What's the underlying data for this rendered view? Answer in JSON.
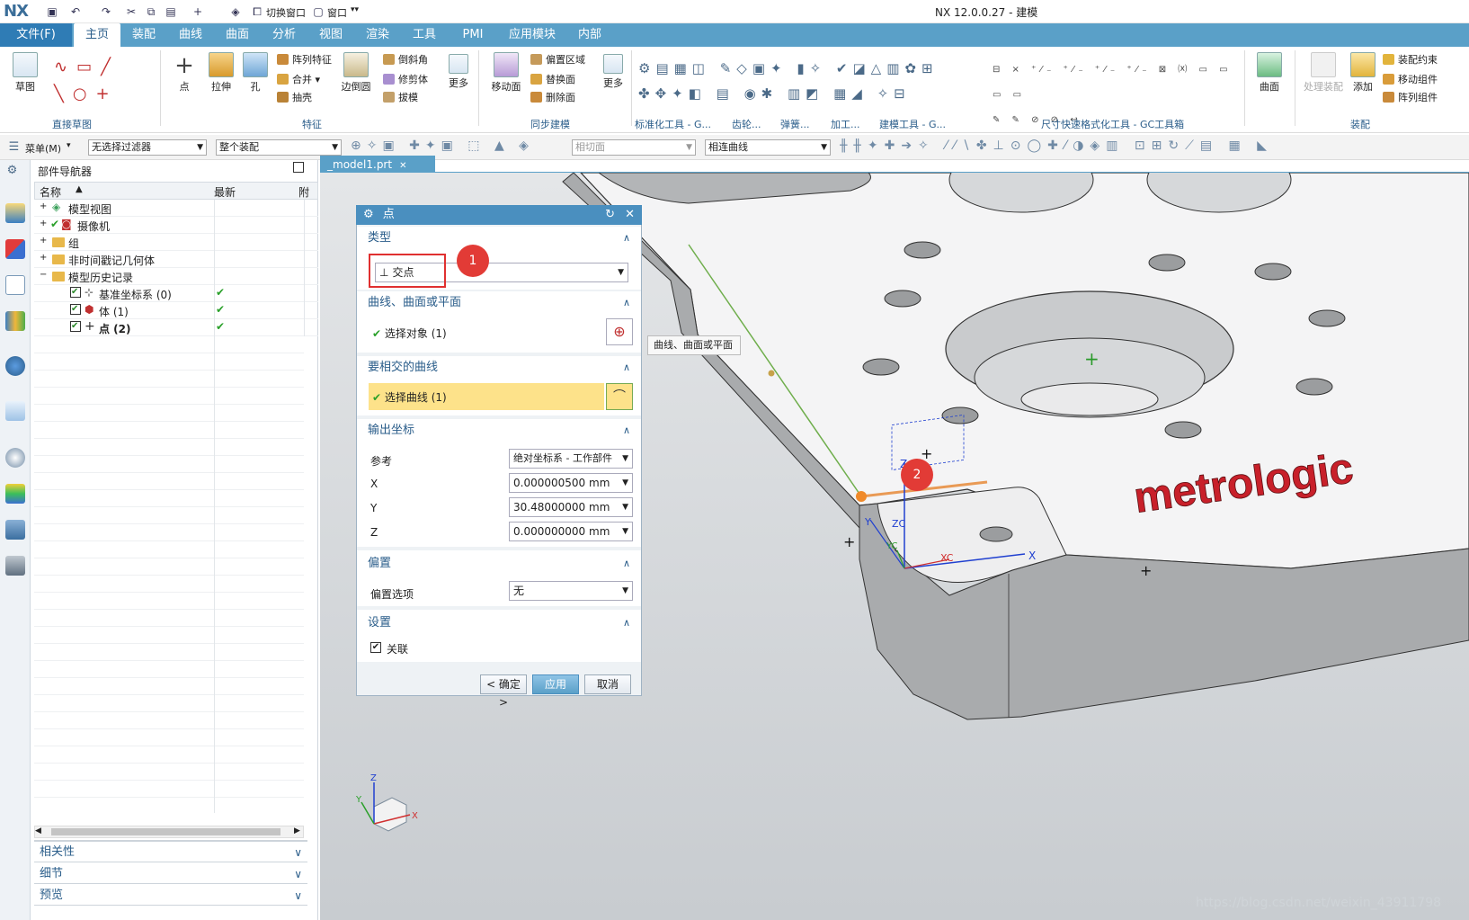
{
  "app": {
    "logo": "NX",
    "title": "NX 12.0.0.27 - 建模",
    "quick_access": {
      "switch_window": "切换窗口",
      "window_menu": "窗口"
    }
  },
  "tabs": [
    {
      "label": "文件(F)"
    },
    {
      "label": "主页"
    },
    {
      "label": "装配"
    },
    {
      "label": "曲线"
    },
    {
      "label": "曲面"
    },
    {
      "label": "分析"
    },
    {
      "label": "视图"
    },
    {
      "label": "渲染"
    },
    {
      "label": "工具"
    },
    {
      "label": "PMI"
    },
    {
      "label": "应用模块"
    },
    {
      "label": "内部"
    }
  ],
  "ribbon": {
    "sketch": "草图",
    "direct_sketch_group": "直接草图",
    "point": "点",
    "extrude": "拉伸",
    "hole": "孔",
    "pattern_feature": "阵列特征",
    "unite": "合并",
    "shell": "抽壳",
    "edge_blend": "边倒圆",
    "chamfer": "倒斜角",
    "trim_body": "修剪体",
    "draft": "拔模",
    "more1": "更多",
    "feature_group": "特征",
    "move_face": "移动面",
    "offset_region": "偏置区域",
    "replace_face": "替换面",
    "delete_face": "删除面",
    "more2": "更多",
    "sync_group": "同步建模",
    "std_tools_group": "标准化工具 - G...",
    "gear_group": "齿轮...",
    "spring_group": "弹簧...",
    "process_group": "加工...",
    "modeling_tools_group": "建模工具 - G...",
    "dim_group": "尺寸快速格式化工具 - GC工具箱",
    "surface": "曲面",
    "process_assembly": "处理装配",
    "add": "添加",
    "assembly_constraint": "装配约束",
    "move_component": "移动组件",
    "pattern_component": "阵列组件",
    "assembly_group": "装配"
  },
  "selbar": {
    "menu": "菜单(M)",
    "filter": "无选择过滤器",
    "scope": "整个装配",
    "face_rule": "相切面",
    "curve_rule": "相连曲线"
  },
  "navigator": {
    "title": "部件导航器",
    "col_name": "名称",
    "col_latest": "最新",
    "col_extra": "附",
    "rows": [
      {
        "label": "模型视图",
        "indent": 0,
        "latest": ""
      },
      {
        "label": "摄像机",
        "indent": 0,
        "latest": ""
      },
      {
        "label": "组",
        "indent": 0,
        "latest": ""
      },
      {
        "label": "非时间戳记几何体",
        "indent": 0,
        "latest": ""
      },
      {
        "label": "模型历史记录",
        "indent": 0,
        "latest": ""
      },
      {
        "label": "基准坐标系 (0)",
        "indent": 1,
        "latest": "✔"
      },
      {
        "label": "体 (1)",
        "indent": 1,
        "latest": "✔"
      },
      {
        "label": "点 (2)",
        "indent": 1,
        "latest": "✔"
      }
    ],
    "panels": [
      "相关性",
      "细节",
      "预览"
    ]
  },
  "graphics": {
    "tab_label": "_model1.prt",
    "text_on_part": "metrologic",
    "triad": {
      "x": "X",
      "y": "Y",
      "z": "Z",
      "xc": "XC",
      "yc": "YC",
      "zc": "ZC"
    }
  },
  "dialog": {
    "title": "点",
    "type_section": "类型",
    "type_value": "交点",
    "curves_section": "曲线、曲面或平面",
    "select_object": "选择对象 (1)",
    "intersect_section": "要相交的曲线",
    "select_curve": "选择曲线 (1)",
    "output_section": "输出坐标",
    "ref_label": "参考",
    "ref_value": "绝对坐标系 - 工作部件",
    "x_label": "X",
    "x_value": "0.000000500",
    "y_label": "Y",
    "y_value": "30.48000000",
    "z_label": "Z",
    "z_value": "0.000000000",
    "unit": "mm",
    "offset_section": "偏置",
    "offset_label": "偏置选项",
    "offset_value": "无",
    "settings_section": "设置",
    "associative": "关联",
    "ok": "< 确定 >",
    "apply": "应用",
    "cancel": "取消"
  },
  "tooltip": "曲线、曲面或平面",
  "annotations": {
    "badge1": "1",
    "badge2": "2"
  },
  "watermark": "https://blog.csdn.net/weixin_43911798",
  "colors": {
    "accent": "#5aa0c8",
    "dialog_title": "#4a8fbf",
    "highlight": "#fde28a",
    "badge": "#e23b36"
  }
}
